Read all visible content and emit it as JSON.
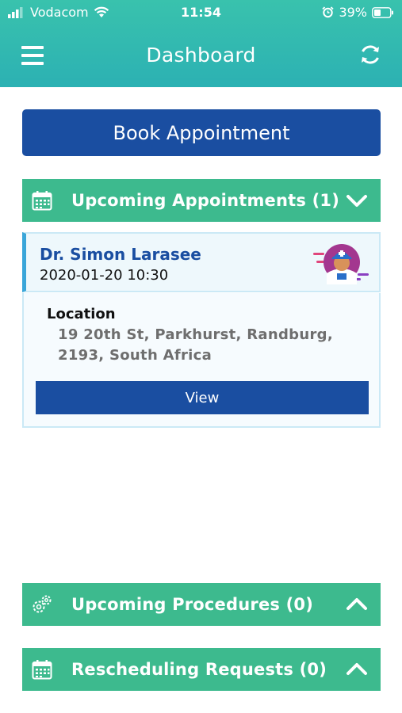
{
  "status_bar": {
    "carrier": "Vodacom",
    "time": "11:54",
    "battery": "39%"
  },
  "header": {
    "title": "Dashboard",
    "menu_icon": "hamburger-menu-icon",
    "refresh_icon": "refresh-icon"
  },
  "book_button": {
    "label": "Book Appointment"
  },
  "sections": {
    "upcoming_appointments": {
      "title": "Upcoming Appointments (1)",
      "icon": "calendar-icon",
      "expanded": true,
      "appointments": [
        {
          "doctor": "Dr. Simon Larasee",
          "datetime": "2020-01-20 10:30",
          "location_label": "Location",
          "location": "19 20th St, Parkhurst, Randburg, 2193, South Africa",
          "view_label": "View"
        }
      ]
    },
    "upcoming_procedures": {
      "title": "Upcoming Procedures (0)",
      "icon": "gears-icon",
      "expanded": false
    },
    "rescheduling_requests": {
      "title": "Rescheduling Requests (0)",
      "icon": "calendar-icon",
      "expanded": false
    }
  },
  "colors": {
    "header_gradient_top": "#39c2ad",
    "header_gradient_bottom": "#2cb1b3",
    "primary_blue": "#1a4ea1",
    "section_green": "#3dba8e",
    "card_border": "#cbe9f6",
    "card_accent": "#3aa6d9"
  }
}
